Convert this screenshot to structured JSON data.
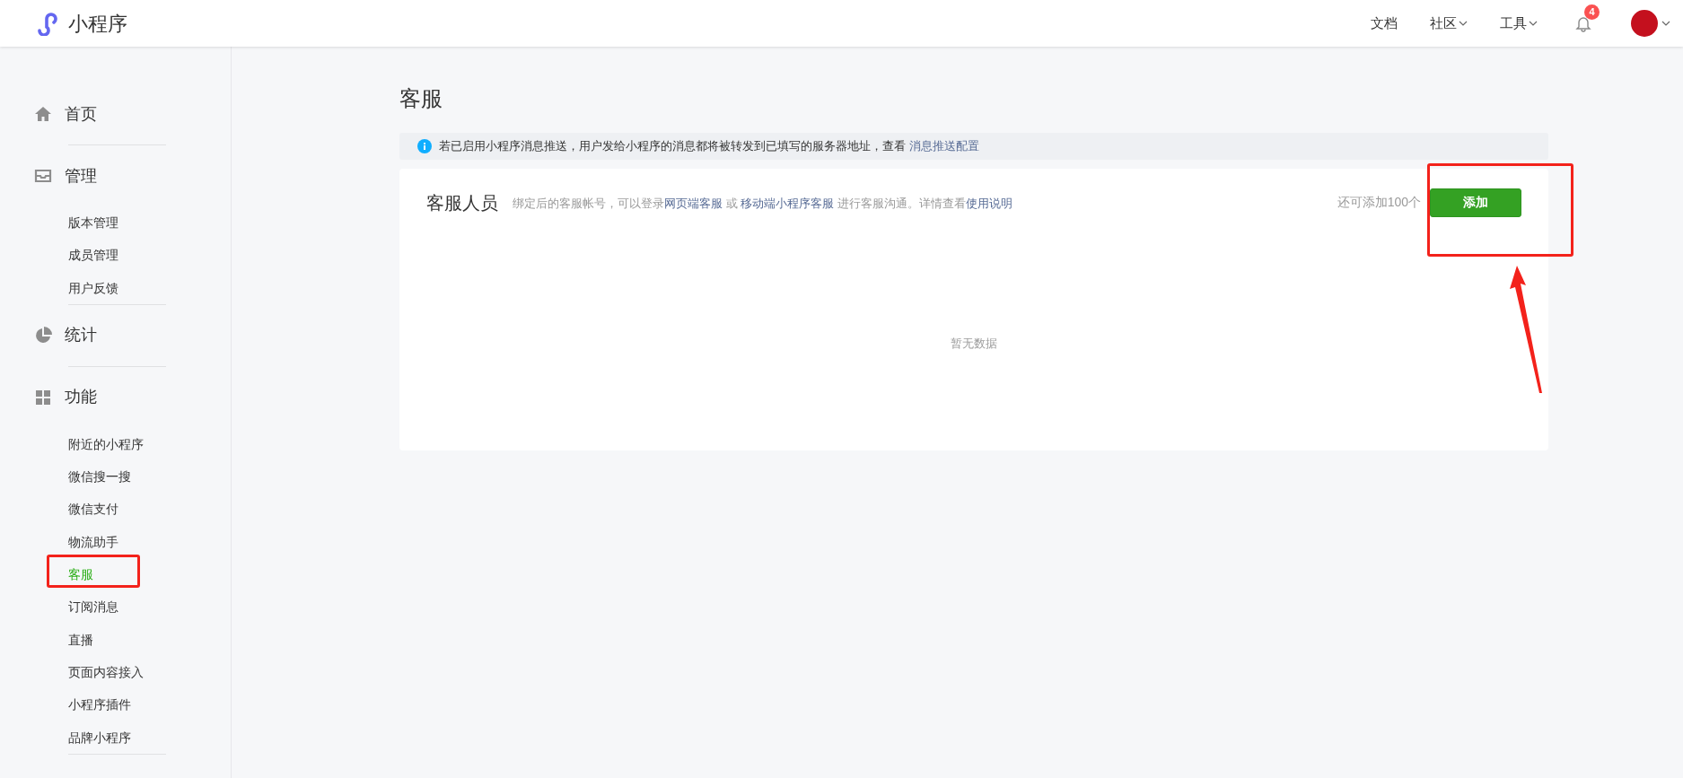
{
  "header": {
    "logo_text": "小程序",
    "nav": [
      {
        "label": "文档",
        "dropdown": false
      },
      {
        "label": "社区",
        "dropdown": true
      },
      {
        "label": "工具",
        "dropdown": true
      }
    ],
    "notification_count": "4"
  },
  "sidebar": {
    "sections": [
      {
        "label": "首页"
      },
      {
        "label": "管理",
        "children": [
          {
            "label": "版本管理",
            "selected": false
          },
          {
            "label": "成员管理",
            "selected": false
          },
          {
            "label": "用户反馈",
            "selected": false
          }
        ]
      },
      {
        "label": "统计"
      },
      {
        "label": "功能",
        "children": [
          {
            "label": "附近的小程序",
            "selected": false
          },
          {
            "label": "微信搜一搜",
            "selected": false
          },
          {
            "label": "微信支付",
            "selected": false
          },
          {
            "label": "物流助手",
            "selected": false
          },
          {
            "label": "客服",
            "selected": true
          },
          {
            "label": "订阅消息",
            "selected": false
          },
          {
            "label": "直播",
            "selected": false
          },
          {
            "label": "页面内容接入",
            "selected": false
          },
          {
            "label": "小程序插件",
            "selected": false
          },
          {
            "label": "品牌小程序",
            "selected": false
          }
        ]
      }
    ]
  },
  "page": {
    "title": "客服",
    "notice": {
      "segments": [
        {
          "kind": "text",
          "text": "若已启用小程序消息推送，用户发给小程序的消息都将被转发到已填写的服务器地址，查看 "
        },
        {
          "kind": "link",
          "text": "消息推送配置"
        }
      ]
    },
    "panel": {
      "title": "客服人员",
      "description": [
        {
          "kind": "text",
          "text": "绑定后的客服帐号，可以登录"
        },
        {
          "kind": "link",
          "text": "网页端客服"
        },
        {
          "kind": "text",
          "text": " 或 "
        },
        {
          "kind": "link",
          "text": "移动端小程序客服"
        },
        {
          "kind": "text",
          "text": " 进行客服沟通。详情查看"
        },
        {
          "kind": "link",
          "text": "使用说明"
        }
      ],
      "quota": "还可添加100个",
      "add_button": "添加",
      "empty_text": "暂无数据"
    }
  }
}
